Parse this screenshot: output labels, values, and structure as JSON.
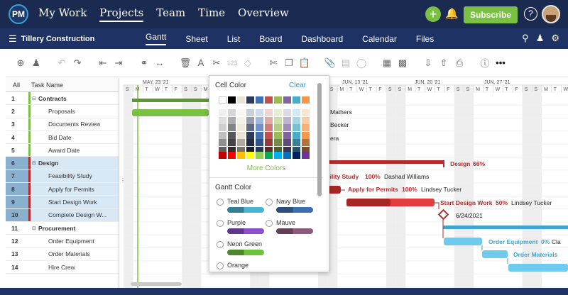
{
  "topbar": {
    "logo": "PM",
    "nav": [
      "My Work",
      "Projects",
      "Team",
      "Time",
      "Overview"
    ],
    "active_nav": 1,
    "subscribe_label": "Subscribe",
    "help_label": "?",
    "plus_label": "+"
  },
  "subbar": {
    "project_name": "Tillery Construction",
    "views": [
      "Gantt",
      "Sheet",
      "List",
      "Board",
      "Dashboard",
      "Calendar",
      "Files"
    ],
    "active_view": 0
  },
  "grid": {
    "col_all": "All",
    "col_task": "Task Name",
    "rows": [
      {
        "num": "1",
        "name": "Contracts",
        "type": "grp",
        "color": "#7ac143"
      },
      {
        "num": "2",
        "name": "Proposals",
        "type": "child",
        "color": "#7ac143"
      },
      {
        "num": "3",
        "name": "Documents Review",
        "type": "child",
        "color": "#7ac143"
      },
      {
        "num": "4",
        "name": "Bid Date",
        "type": "child",
        "color": "#7ac143"
      },
      {
        "num": "5",
        "name": "Award Date",
        "type": "child",
        "color": "#7ac143"
      },
      {
        "num": "6",
        "name": "Design",
        "type": "grp sel",
        "color": "#b22b2b"
      },
      {
        "num": "7",
        "name": "Feasibility Study",
        "type": "child sel",
        "color": "#b22b2b"
      },
      {
        "num": "8",
        "name": "Apply for Permits",
        "type": "child sel",
        "color": "#b22b2b"
      },
      {
        "num": "9",
        "name": "Start Design Work",
        "type": "child sel",
        "color": "#b22b2b"
      },
      {
        "num": "10",
        "name": "Complete Design W...",
        "type": "child sel",
        "color": "#b22b2b"
      },
      {
        "num": "11",
        "name": "Procurement",
        "type": "grp",
        "color": "#fff"
      },
      {
        "num": "12",
        "name": "Order Equipment",
        "type": "child",
        "color": "#fff"
      },
      {
        "num": "13",
        "name": "Order Materials",
        "type": "child",
        "color": "#fff"
      },
      {
        "num": "14",
        "name": "Hire Crew",
        "type": "child",
        "color": "#fff"
      }
    ]
  },
  "timeline": {
    "months": [
      {
        "label": "MAY, 23 '21"
      },
      {
        "label": "JUN, 13 '21"
      },
      {
        "label": "JUN, 20 '21"
      },
      {
        "label": "JUN, 27 '21"
      }
    ],
    "day_letters": [
      "S",
      "M",
      "T",
      "W",
      "T",
      "F",
      "S"
    ]
  },
  "gantt_labels": {
    "mathers": "Mathers",
    "becker": "Becker",
    "era": "era",
    "design": "Design",
    "design_pct": "66%",
    "feas_name": "ibility Study",
    "feas_pct": "100%",
    "feas_person": "Dashad Williams",
    "permits_name": "Apply for Permits",
    "permits_pct": "100%",
    "permits_person": "Lindsey Tucker",
    "sdw_name": "Start Design Work",
    "sdw_pct": "50%",
    "sdw_person": "Lindsey Tucker",
    "milestone_date": "6/24/2021",
    "order_eq": "Order Equipment",
    "order_eq_pct": "0%",
    "order_eq_person": "Cla",
    "order_mat": "Order Materials"
  },
  "popup": {
    "cell_color_title": "Cell Color",
    "clear_label": "Clear",
    "more_colors_label": "More Colors",
    "gantt_color_title": "Gantt Color",
    "options": [
      {
        "label": "Teal Blue",
        "color": "#4ab3d4"
      },
      {
        "label": "Navy Blue",
        "color": "#3d6fb0"
      },
      {
        "label": "Purple",
        "color": "#8b4fc9"
      },
      {
        "label": "Mauve",
        "color": "#8c5a7c"
      },
      {
        "label": "Neon Green",
        "color": "#6ec13c"
      },
      {
        "label": "Orange",
        "color": "#f08a24"
      }
    ],
    "palette_top": [
      "#ffffff",
      "#000000",
      "#e8e3d2",
      "#2a3a5c",
      "#3f6fb4",
      "#c0504d",
      "#9bbb59",
      "#8064a2",
      "#4bacc6",
      "#f79646"
    ],
    "palette_accent": [
      "#c00000",
      "#ff0000",
      "#ffc000",
      "#ffff00",
      "#92d050",
      "#00b050",
      "#00b0f0",
      "#0070c0",
      "#002060",
      "#7030a0"
    ]
  },
  "colors": {
    "nav_bg": "#1b2a50",
    "sub_bg": "#1e3264",
    "accent_green": "#7ac143",
    "design_red": "#b22b2b"
  }
}
